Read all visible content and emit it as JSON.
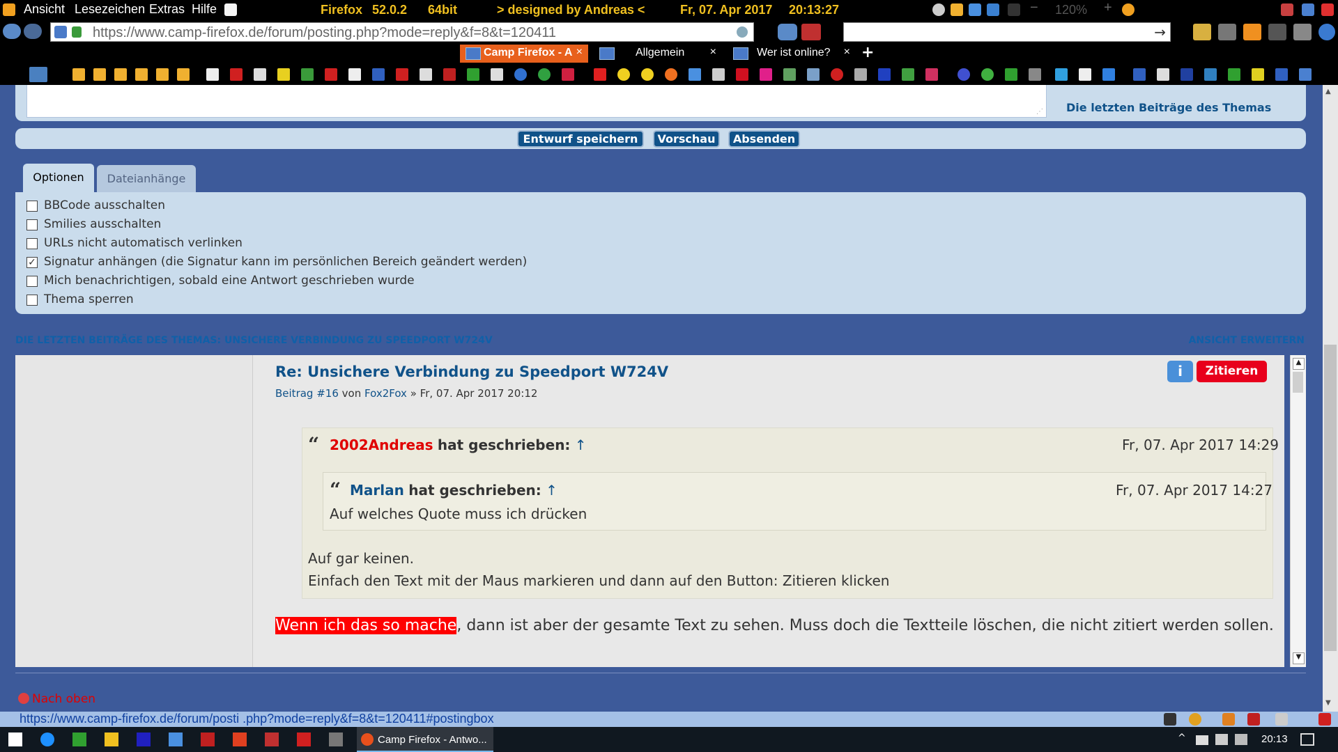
{
  "menubar": {
    "items": [
      "Ansicht",
      "Lesezeichen",
      "Extras",
      "Hilfe"
    ],
    "browser": "Firefox",
    "version": "52.0.2",
    "arch": "64bit",
    "tagline": ">  designed by Andreas  <",
    "date": "Fr, 07. Apr 2017",
    "time": "20:13:27",
    "zoom": "120%"
  },
  "navbar": {
    "url": "https://www.camp-firefox.de/forum/posting.php?mode=reply&f=8&t=120411"
  },
  "tabs": [
    {
      "label": "Camp Firefox - A",
      "close": "×"
    },
    {
      "label": "Allgemein",
      "close": "×"
    },
    {
      "label": "Wer ist online?",
      "close": "×"
    }
  ],
  "new_tab": "+",
  "editor": {
    "last_posts_link": "Die letzten Beiträge des Themas"
  },
  "buttons": {
    "save_draft": "Entwurf speichern",
    "preview": "Vorschau",
    "submit": "Absenden"
  },
  "option_tabs": [
    "Optionen",
    "Dateianhänge"
  ],
  "options": [
    {
      "label": "BBCode ausschalten",
      "checked": false
    },
    {
      "label": "Smilies ausschalten",
      "checked": false
    },
    {
      "label": "URLs nicht automatisch verlinken",
      "checked": false
    },
    {
      "label": "Signatur anhängen (die Signatur kann im persönlichen Bereich geändert werden)",
      "checked": true
    },
    {
      "label": "Mich benachrichtigen, sobald eine Antwort geschrieben wurde",
      "checked": false
    },
    {
      "label": "Thema sperren",
      "checked": false
    }
  ],
  "last_posts": {
    "heading": "Die letzten Beiträge des Themas: Unsichere Verbindung zu Speedport W724V",
    "expand": "Ansicht erweitern"
  },
  "post": {
    "title": "Re: Unsichere Verbindung zu Speedport W724V",
    "meta_prefix": "Beitrag",
    "number": "#16",
    "by": "von",
    "author": "Fox2Fox",
    "date": "» Fr, 07. Apr 2017 20:12",
    "info_button": "i",
    "quote_button": "Zitieren",
    "quote1": {
      "author": "2002Andreas",
      "wrote": "hat geschrieben:",
      "arrow": "↑",
      "date": "Fr, 07. Apr 2017 14:29",
      "line1": "Auf gar keinen.",
      "line2": "Einfach den Text mit der Maus markieren und dann auf den Button: Zitieren klicken"
    },
    "quote2": {
      "author": "Marlan",
      "wrote": "hat geschrieben:",
      "arrow": "↑",
      "date": "Fr, 07. Apr 2017 14:27",
      "text": "Auf welches Quote muss ich drücken"
    },
    "text_highlight": "Wenn ich das so mache",
    "text_rest": ", dann ist aber der gesamte Text zu sehen. Muss doch die Textteile löschen, die nicht zitiert werden sollen."
  },
  "nav_up": "Nach oben",
  "statusbar": {
    "url": "https://www.camp-firefox.de/forum/posti .php?mode=reply&f=8&t=120411#postingbox"
  },
  "taskbar": {
    "active_window": "Camp Firefox - Antwo...",
    "clock": "20:13"
  },
  "colors": {
    "page_bg": "#3d5a9a",
    "panel_bg": "#cadcec",
    "link": "#105289",
    "quote_btn": "#e8001c",
    "highlight": "#ff0000"
  }
}
